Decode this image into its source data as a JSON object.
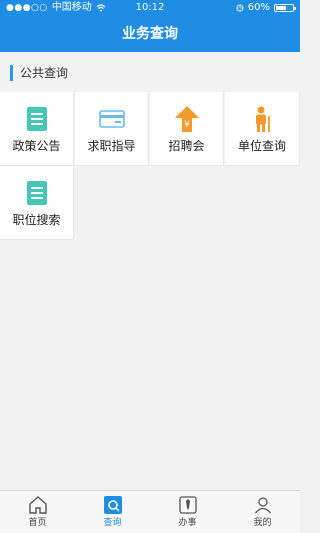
{
  "status": {
    "carrier": "中国移动",
    "time": "10:12",
    "battery": "60%",
    "battery_level": 0.6
  },
  "header": {
    "title": "业务查询"
  },
  "section": {
    "label": "公共查询"
  },
  "grid": {
    "items": [
      {
        "label": "政策公告",
        "icon": "document-list-icon"
      },
      {
        "label": "求职指导",
        "icon": "card-icon"
      },
      {
        "label": "招聘会",
        "icon": "yen-upload-icon"
      },
      {
        "label": "单位查询",
        "icon": "person-cane-icon"
      },
      {
        "label": "职位搜索",
        "icon": "document-list-icon"
      }
    ]
  },
  "tabbar": {
    "items": [
      {
        "label": "首页",
        "icon": "home-icon"
      },
      {
        "label": "查询",
        "icon": "query-icon",
        "active": true
      },
      {
        "label": "办事",
        "icon": "tie-icon"
      },
      {
        "label": "我的",
        "icon": "user-icon"
      }
    ]
  },
  "colors": {
    "brand_blue": "#1e8de3",
    "teal": "#45c6b8",
    "orange": "#f39a2c",
    "light_blue": "#6ab8f0"
  }
}
